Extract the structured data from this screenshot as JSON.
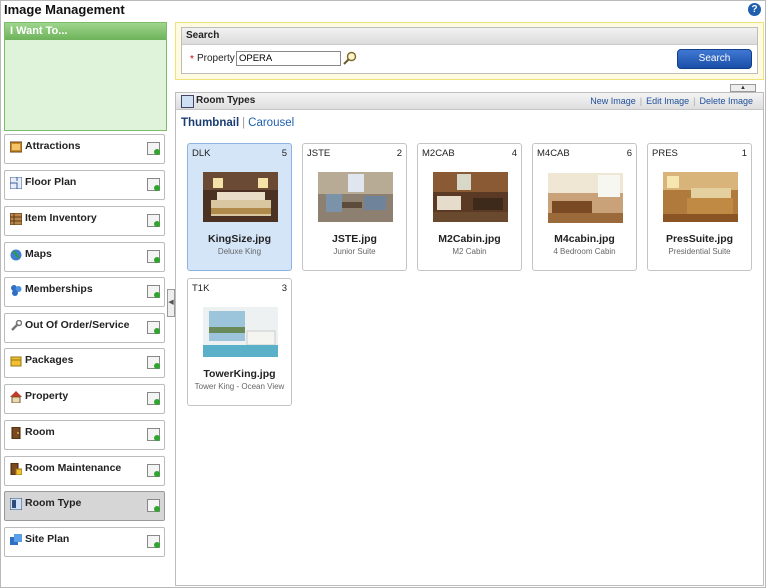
{
  "app": {
    "title": "Image Management",
    "help_glyph": "?"
  },
  "left_panel": {
    "header": "I Want To...",
    "items": [
      {
        "label": "Attractions",
        "icon": "attractions-icon",
        "selected": false
      },
      {
        "label": "Floor Plan",
        "icon": "floor-plan-icon",
        "selected": false
      },
      {
        "label": "Item Inventory",
        "icon": "item-inventory-icon",
        "selected": false
      },
      {
        "label": "Maps",
        "icon": "globe-icon",
        "selected": false
      },
      {
        "label": "Memberships",
        "icon": "memberships-icon",
        "selected": false
      },
      {
        "label": "Out Of Order/Service",
        "icon": "wrench-icon",
        "selected": false
      },
      {
        "label": "Packages",
        "icon": "package-icon",
        "selected": false
      },
      {
        "label": "Property",
        "icon": "house-icon",
        "selected": false
      },
      {
        "label": "Room",
        "icon": "door-icon",
        "selected": false
      },
      {
        "label": "Room Maintenance",
        "icon": "room-maintenance-icon",
        "selected": false
      },
      {
        "label": "Room Type",
        "icon": "room-type-icon",
        "selected": true
      },
      {
        "label": "Site Plan",
        "icon": "site-plan-icon",
        "selected": false
      }
    ]
  },
  "search": {
    "header": "Search",
    "required_marker": "*",
    "property_label": "Property",
    "property_value": "OPERA",
    "button_label": "Search"
  },
  "room_types": {
    "title": "Room Types",
    "links": {
      "new": "New Image",
      "edit": "Edit Image",
      "delete": "Delete Image"
    },
    "tabs": {
      "thumbnail": "Thumbnail",
      "carousel": "Carousel",
      "active": "thumbnail"
    },
    "cards": [
      {
        "code": "DLK",
        "count": "5",
        "filename": "KingSize.jpg",
        "description": "Deluxe King",
        "selected": true
      },
      {
        "code": "JSTE",
        "count": "2",
        "filename": "JSTE.jpg",
        "description": "Junior Suite",
        "selected": false
      },
      {
        "code": "M2CAB",
        "count": "4",
        "filename": "M2Cabin.jpg",
        "description": "M2 Cabin",
        "selected": false
      },
      {
        "code": "M4CAB",
        "count": "6",
        "filename": "M4cabin.jpg",
        "description": "4 Bedroom Cabin",
        "selected": false
      },
      {
        "code": "PRES",
        "count": "1",
        "filename": "PresSuite.jpg",
        "description": "Presidential Suite",
        "selected": false
      },
      {
        "code": "T1K",
        "count": "3",
        "filename": "TowerKing.jpg",
        "description": "Tower King - Ocean View",
        "selected": false
      }
    ]
  },
  "colors": {
    "accent_green": "#6db25a",
    "search_button": "#1a4fa8",
    "selected_card": "#d4e5f8",
    "link": "#1f4e9b"
  }
}
